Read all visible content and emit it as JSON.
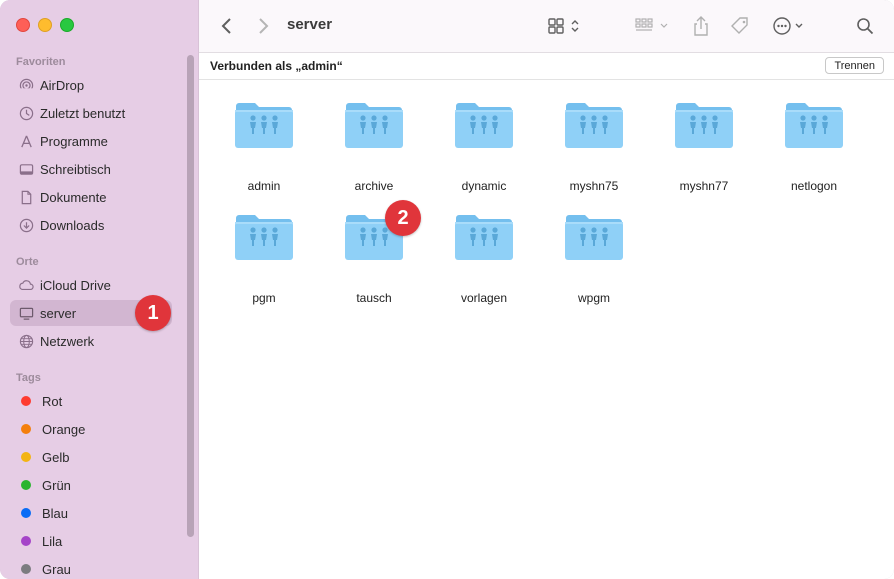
{
  "window": {
    "title": "server"
  },
  "sidebar": {
    "sections": {
      "favorites": "Favoriten",
      "places": "Orte",
      "tags": "Tags"
    },
    "favorites": [
      {
        "label": "AirDrop",
        "icon": "airdrop-icon"
      },
      {
        "label": "Zuletzt benutzt",
        "icon": "clock-icon"
      },
      {
        "label": "Programme",
        "icon": "apps-icon"
      },
      {
        "label": "Schreibtisch",
        "icon": "desktop-icon"
      },
      {
        "label": "Dokumente",
        "icon": "document-icon"
      },
      {
        "label": "Downloads",
        "icon": "download-icon"
      }
    ],
    "places": [
      {
        "label": "iCloud Drive",
        "icon": "cloud-icon"
      },
      {
        "label": "server",
        "icon": "display-icon",
        "selected": true
      },
      {
        "label": "Netzwerk",
        "icon": "globe-icon"
      }
    ],
    "tags": [
      {
        "label": "Rot",
        "color": "#fe3b30"
      },
      {
        "label": "Orange",
        "color": "#f47f0c"
      },
      {
        "label": "Gelb",
        "color": "#f3b412"
      },
      {
        "label": "Grün",
        "color": "#2ab42f"
      },
      {
        "label": "Blau",
        "color": "#0a6cf5"
      },
      {
        "label": "Lila",
        "color": "#a544c8"
      },
      {
        "label": "Grau",
        "color": "#7c7c80"
      }
    ]
  },
  "connection": {
    "text": "Verbunden als „admin“",
    "disconnect_label": "Trennen"
  },
  "folders": [
    {
      "name": "admin"
    },
    {
      "name": "archive"
    },
    {
      "name": "dynamic"
    },
    {
      "name": "myshn75"
    },
    {
      "name": "myshn77"
    },
    {
      "name": "netlogon"
    },
    {
      "name": "pgm"
    },
    {
      "name": "tausch"
    },
    {
      "name": "vorlagen"
    },
    {
      "name": "wpgm"
    }
  ],
  "badges": {
    "one": "1",
    "two": "2"
  },
  "colors": {
    "sidebar_bg": "#e6cde5",
    "folder_blue": "#8fd0f7",
    "badge_red": "#e0353b"
  }
}
